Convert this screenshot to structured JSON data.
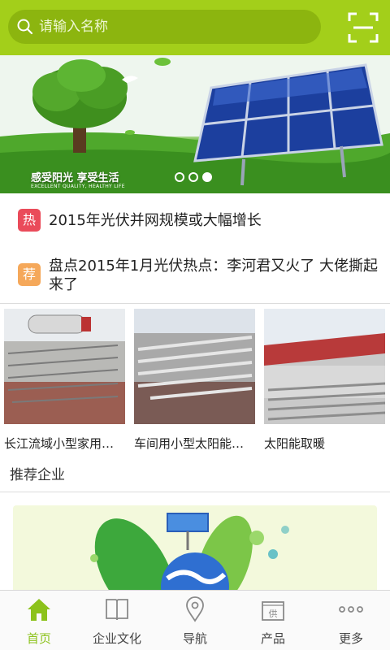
{
  "search": {
    "placeholder": "请输入名称"
  },
  "banner": {
    "slogan": "感受阳光 享受生活",
    "slogan_en": "EXCELLENT QUALITY, HEALTHY LIFE",
    "slide_count": 3,
    "active_slide": 3
  },
  "news": [
    {
      "badge": "热",
      "title": "2015年光伏并网规模或大幅增长"
    },
    {
      "badge": "荐",
      "title": "盘点2015年1月光伏热点：李河君又火了 大佬撕起来了"
    }
  ],
  "products": [
    {
      "caption": "长江流域小型家用太阳能"
    },
    {
      "caption": "车间用小型太阳能热水器"
    },
    {
      "caption": "太阳能取暖"
    }
  ],
  "section": {
    "recommended_title": "推荐企业"
  },
  "tabbar": {
    "items": [
      {
        "label": "首页",
        "icon": "home-icon",
        "active": true
      },
      {
        "label": "企业文化",
        "icon": "book-icon",
        "active": false
      },
      {
        "label": "导航",
        "icon": "location-pin-icon",
        "active": false
      },
      {
        "label": "产品",
        "icon": "supply-icon",
        "active": false
      },
      {
        "label": "更多",
        "icon": "more-icon",
        "active": false
      }
    ]
  },
  "colors": {
    "brand": "#a3cf1a",
    "search_bg": "#8cb50f",
    "hot_badge": "#ea4b5a",
    "recommend_badge": "#f5a85a",
    "active_tab": "#8cc21c"
  }
}
